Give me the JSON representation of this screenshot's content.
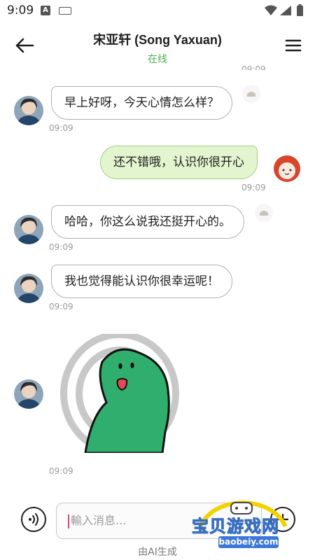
{
  "status_bar": {
    "time": "9:09",
    "icons": [
      "a-notification-icon",
      "keyboard-icon",
      "wifi-icon",
      "signal-icon",
      "battery-icon"
    ]
  },
  "header": {
    "title": "宋亚轩 (Song Yaxuan)",
    "status": "在线",
    "back_icon": "back-arrow-icon",
    "menu_icon": "menu-icon",
    "status_color": "#4caf50"
  },
  "clipped_time": "09:09",
  "messages": [
    {
      "from": "bot",
      "text": "早上好呀，今天心情怎么样？",
      "time": "09:09"
    },
    {
      "from": "user",
      "text": "还不错哦，认识你很开心",
      "time": "09:09"
    },
    {
      "from": "bot",
      "text": "哈哈，你这么说我还挺开心的。",
      "time": "09:09"
    },
    {
      "from": "bot",
      "text": "我也觉得能认识你很幸运呢！",
      "time": "09:09"
    },
    {
      "from": "bot",
      "type": "sticker",
      "sticker": "green-dinosaur-sticker",
      "time": "09:09"
    }
  ],
  "colors": {
    "user_bubble": "#e3f5cf",
    "user_bubble_border": "#9ad27a",
    "bot_bubble": "#ffffff",
    "caret": "#e0407a"
  },
  "input": {
    "placeholder": "輸入消息...",
    "voice_icon": "voice-icon",
    "plus_icon": "plus-icon"
  },
  "footer": {
    "note": "由AI生成"
  },
  "watermark": {
    "title": "宝贝游戏网",
    "url": "baobeiy.com"
  }
}
